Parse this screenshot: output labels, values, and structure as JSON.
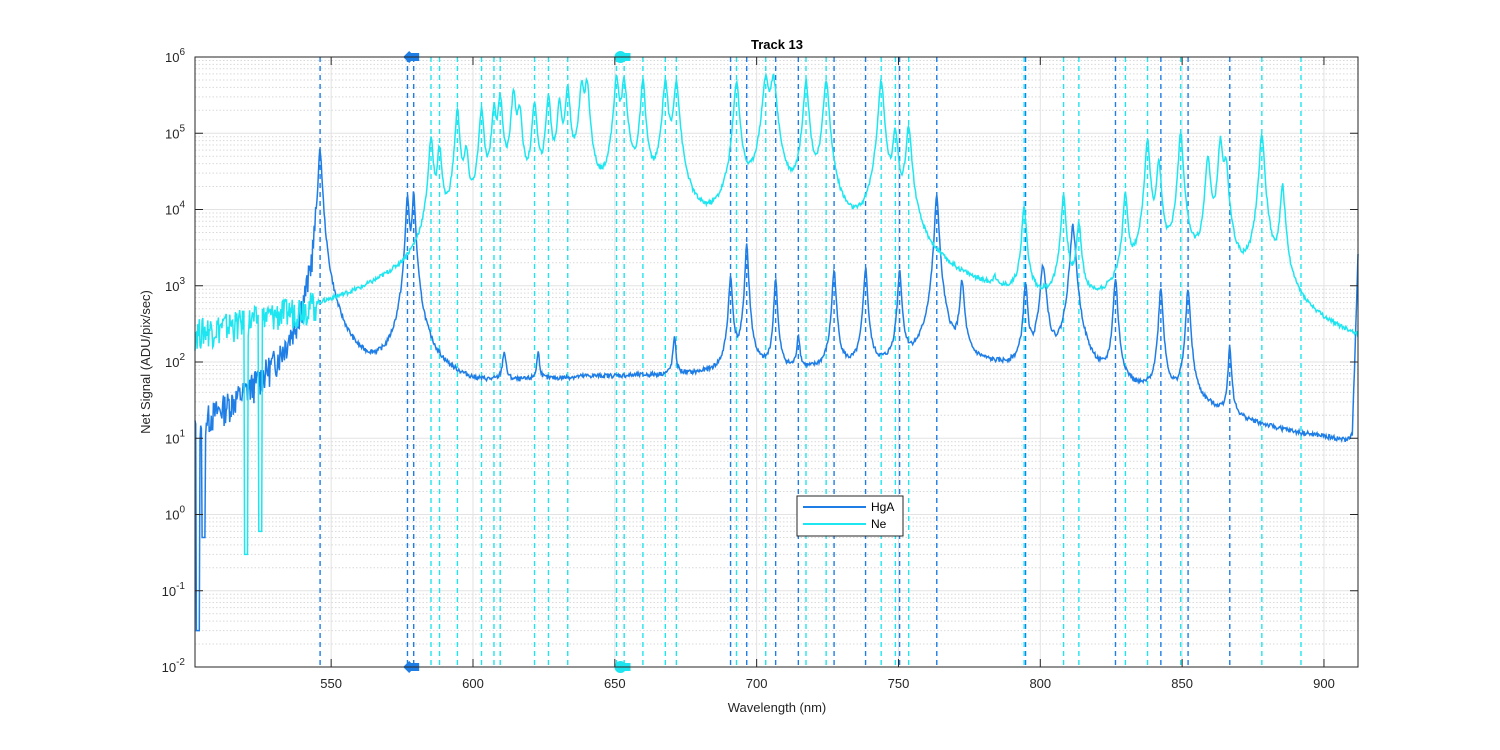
{
  "chart_data": {
    "type": "line",
    "title": "Track 13",
    "xlabel": "Wavelength (nm)",
    "ylabel": "Net Signal (ADU/pix/sec)",
    "xlim": [
      502,
      912
    ],
    "ylim": [
      0.01,
      1000000
    ],
    "yscale": "log",
    "grid": true,
    "legend_position": "bottom-center",
    "x_ticks": [
      550,
      600,
      650,
      700,
      750,
      800,
      850,
      900
    ],
    "x_tick_labels": [
      "550",
      "600",
      "650",
      "700",
      "750",
      "800",
      "850",
      "900"
    ],
    "y_ticks": [
      0.01,
      0.1,
      1,
      10,
      100,
      1000,
      10000,
      100000,
      1000000
    ],
    "y_tick_labels": [
      {
        "base": "10",
        "exp": "-2"
      },
      {
        "base": "10",
        "exp": "-1"
      },
      {
        "base": "10",
        "exp": "0"
      },
      {
        "base": "10",
        "exp": "1"
      },
      {
        "base": "10",
        "exp": "2"
      },
      {
        "base": "10",
        "exp": "3"
      },
      {
        "base": "10",
        "exp": "4"
      },
      {
        "base": "10",
        "exp": "5"
      },
      {
        "base": "10",
        "exp": "6"
      }
    ],
    "series": [
      {
        "name": "HgA",
        "color": "#1e7ee6",
        "baseline": [
          [
            502,
            1.5
          ],
          [
            506,
            3
          ],
          [
            512,
            5
          ],
          [
            520,
            8
          ],
          [
            530,
            15
          ],
          [
            536,
            30
          ],
          [
            540,
            35
          ],
          [
            543,
            38
          ],
          [
            552,
            35
          ],
          [
            560,
            30
          ],
          [
            570,
            32
          ],
          [
            575,
            40
          ],
          [
            581,
            60
          ],
          [
            585,
            45
          ],
          [
            600,
            40
          ],
          [
            620,
            50
          ],
          [
            640,
            60
          ],
          [
            680,
            65
          ],
          [
            710,
            70
          ],
          [
            740,
            72
          ],
          [
            760,
            75
          ],
          [
            780,
            80
          ],
          [
            790,
            70
          ],
          [
            800,
            55
          ],
          [
            810,
            50
          ],
          [
            820,
            45
          ],
          [
            830,
            35
          ],
          [
            840,
            30
          ],
          [
            850,
            25
          ],
          [
            860,
            20
          ],
          [
            870,
            15
          ],
          [
            880,
            12
          ],
          [
            890,
            10
          ],
          [
            900,
            9
          ],
          [
            908,
            8
          ],
          [
            910,
            10
          ],
          [
            912,
            2500
          ]
        ],
        "dips": [
          [
            503,
            0.03
          ],
          [
            505,
            0.5
          ]
        ],
        "peaks": [
          [
            546.1,
            60000,
            0.6
          ],
          [
            576.9,
            15000,
            0.5
          ],
          [
            579.1,
            16000,
            0.5
          ],
          [
            611,
            80,
            0.6
          ],
          [
            623,
            75,
            0.5
          ],
          [
            671,
            140,
            0.5
          ],
          [
            690.8,
            1200,
            0.6
          ],
          [
            696.5,
            3500,
            0.5
          ],
          [
            706.7,
            1200,
            0.5
          ],
          [
            714.7,
            150,
            0.5
          ],
          [
            727.3,
            1500,
            0.6
          ],
          [
            738.4,
            1600,
            0.6
          ],
          [
            750.4,
            1500,
            0.6
          ],
          [
            763.5,
            15000,
            0.6
          ],
          [
            772.4,
            1000,
            0.7
          ],
          [
            794.8,
            1000,
            0.6
          ],
          [
            801,
            1800,
            0.9
          ],
          [
            811.5,
            6000,
            0.8
          ],
          [
            826.5,
            1200,
            0.6
          ],
          [
            842.5,
            900,
            0.6
          ],
          [
            852.1,
            900,
            0.6
          ],
          [
            866.8,
            140,
            0.5
          ]
        ]
      },
      {
        "name": "Ne",
        "color": "#1ee6f0",
        "baseline": [
          [
            502,
            1.5
          ],
          [
            510,
            5
          ],
          [
            520,
            10
          ],
          [
            530,
            15
          ],
          [
            540,
            30
          ],
          [
            550,
            40
          ],
          [
            560,
            50
          ],
          [
            570,
            120
          ],
          [
            575,
            150
          ],
          [
            580,
            350
          ],
          [
            585,
            400
          ],
          [
            600,
            700
          ],
          [
            630,
            1500
          ],
          [
            650,
            1500
          ],
          [
            665,
            1500
          ],
          [
            680,
            1000
          ],
          [
            690,
            1200
          ],
          [
            700,
            2000
          ],
          [
            710,
            800
          ],
          [
            720,
            700
          ],
          [
            730,
            900
          ],
          [
            740,
            600
          ],
          [
            750,
            400
          ],
          [
            760,
            250
          ],
          [
            770,
            140
          ],
          [
            780,
            120
          ],
          [
            790,
            100
          ],
          [
            800,
            80
          ],
          [
            810,
            80
          ],
          [
            820,
            90
          ],
          [
            830,
            150
          ],
          [
            840,
            150
          ],
          [
            850,
            150
          ],
          [
            860,
            100
          ],
          [
            870,
            100
          ],
          [
            880,
            100
          ],
          [
            890,
            100
          ],
          [
            900,
            30
          ],
          [
            905,
            20
          ],
          [
            910,
            15
          ],
          [
            912,
            10
          ]
        ],
        "dips": [
          [
            520,
            0.3
          ],
          [
            525,
            0.6
          ]
        ],
        "peaks": [
          [
            585.2,
            80000,
            0.7
          ],
          [
            588.2,
            60000,
            0.7
          ],
          [
            594.5,
            200000,
            0.7
          ],
          [
            597.6,
            50000,
            0.7
          ],
          [
            603,
            200000,
            0.7
          ],
          [
            607.4,
            200000,
            0.7
          ],
          [
            609.6,
            300000,
            0.7
          ],
          [
            614.3,
            350000,
            0.7
          ],
          [
            616.4,
            200000,
            0.7
          ],
          [
            621.7,
            250000,
            0.7
          ],
          [
            626.6,
            300000,
            0.7
          ],
          [
            630.5,
            250000,
            0.7
          ],
          [
            633.4,
            400000,
            0.7
          ],
          [
            638.3,
            450000,
            0.7
          ],
          [
            640.2,
            450000,
            0.7
          ],
          [
            650.6,
            500000,
            0.8
          ],
          [
            653.3,
            480000,
            0.8
          ],
          [
            659.9,
            480000,
            0.7
          ],
          [
            667.8,
            480000,
            0.8
          ],
          [
            671.7,
            480000,
            0.8
          ],
          [
            692.9,
            480000,
            0.8
          ],
          [
            703.2,
            500000,
            1.0
          ],
          [
            705.9,
            500000,
            1.0
          ],
          [
            717.4,
            480000,
            0.8
          ],
          [
            724.5,
            500000,
            0.8
          ],
          [
            743.9,
            480000,
            0.8
          ],
          [
            748.9,
            100000,
            0.8
          ],
          [
            753.6,
            120000,
            0.8
          ],
          [
            783.9,
            400,
            0.5
          ],
          [
            794.3,
            10000,
            0.7
          ],
          [
            808.2,
            15000,
            0.7
          ],
          [
            813.6,
            6000,
            0.7
          ],
          [
            830,
            15000,
            0.7
          ],
          [
            837.8,
            80000,
            0.7
          ],
          [
            841.8,
            40000,
            0.7
          ],
          [
            849.5,
            100000,
            0.7
          ],
          [
            859.1,
            50000,
            0.7
          ],
          [
            863.5,
            80000,
            0.7
          ],
          [
            865.4,
            40000,
            0.7
          ],
          [
            878.1,
            100000,
            0.7
          ],
          [
            885.4,
            20000,
            0.7
          ]
        ]
      }
    ],
    "reference_lines": {
      "HgA": {
        "color": "#1e7ee6",
        "x": [
          546.1,
          576.9,
          579.1,
          690.8,
          696.5,
          706.7,
          714.7,
          727.3,
          738.4,
          750.4,
          763.5,
          794.8,
          826.5,
          842.5,
          852.1,
          866.8
        ]
      },
      "Ne": {
        "color": "#1ee6f0",
        "x": [
          585.2,
          588.2,
          594.5,
          603.0,
          607.4,
          609.6,
          621.7,
          626.6,
          633.4,
          650.6,
          653.3,
          659.9,
          667.8,
          671.7,
          692.9,
          703.2,
          717.4,
          724.5,
          743.9,
          748.9,
          753.6,
          794.3,
          808.2,
          813.6,
          830.0,
          837.8,
          849.5,
          878.1,
          891.9
        ]
      }
    },
    "markers": [
      {
        "series": "HgA",
        "x": 577.5,
        "color": "#1e7ee6",
        "shape": "diamond"
      },
      {
        "series": "Ne",
        "x": 652,
        "color": "#1ee6f0",
        "shape": "circle"
      }
    ]
  }
}
